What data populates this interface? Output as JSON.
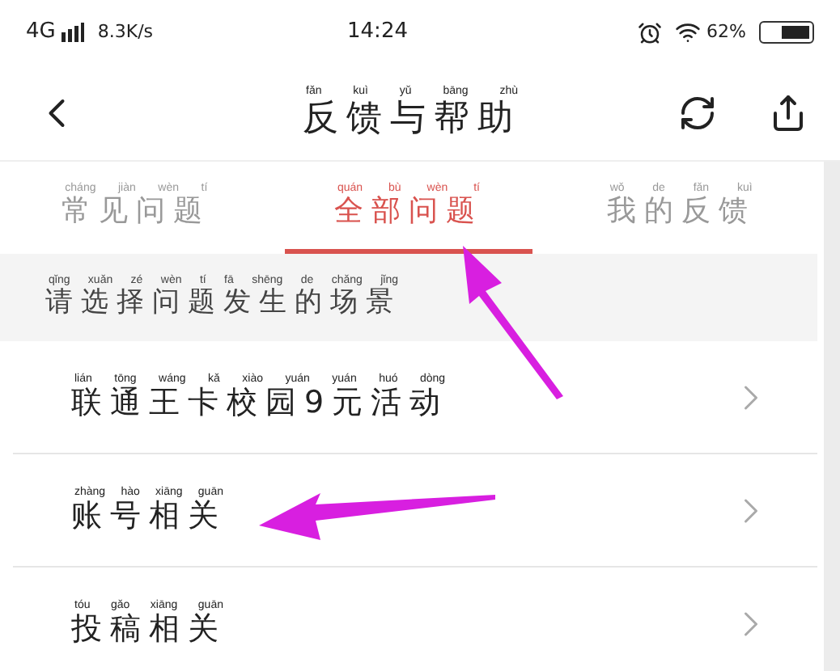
{
  "status_bar": {
    "network": "4G",
    "speed": "8.3K/s",
    "time": "14:24",
    "battery": "62%"
  },
  "header": {
    "title": {
      "text": "反馈与帮助",
      "pinyin": "fǎn kuì yǔ bāng zhù"
    }
  },
  "tabs": [
    {
      "label": {
        "text": "常见问题",
        "pinyin": "cháng jiàn wèn tí"
      },
      "selected": false
    },
    {
      "label": {
        "text": "全部问题",
        "pinyin": "quán bù wèn tí"
      },
      "selected": true
    },
    {
      "label": {
        "text": "我的反馈",
        "pinyin": "wǒ de fǎn kuì"
      },
      "selected": false
    }
  ],
  "section_header": {
    "text": "请选择问题发生的场景",
    "pinyin": "qǐng xuǎn zé wèn tí fā shēng de chǎng jǐng"
  },
  "items": [
    {
      "label": {
        "text": "联通王卡校园9元活动",
        "pinyin": "lián tōng wáng kǎ xiào yuán yuán huó dòng"
      }
    },
    {
      "label": {
        "text": "账号相关",
        "pinyin": "zhàng hào xiāng guān"
      }
    },
    {
      "label": {
        "text": "投稿相关",
        "pinyin": "tóu gǎo xiāng guān"
      }
    }
  ]
}
